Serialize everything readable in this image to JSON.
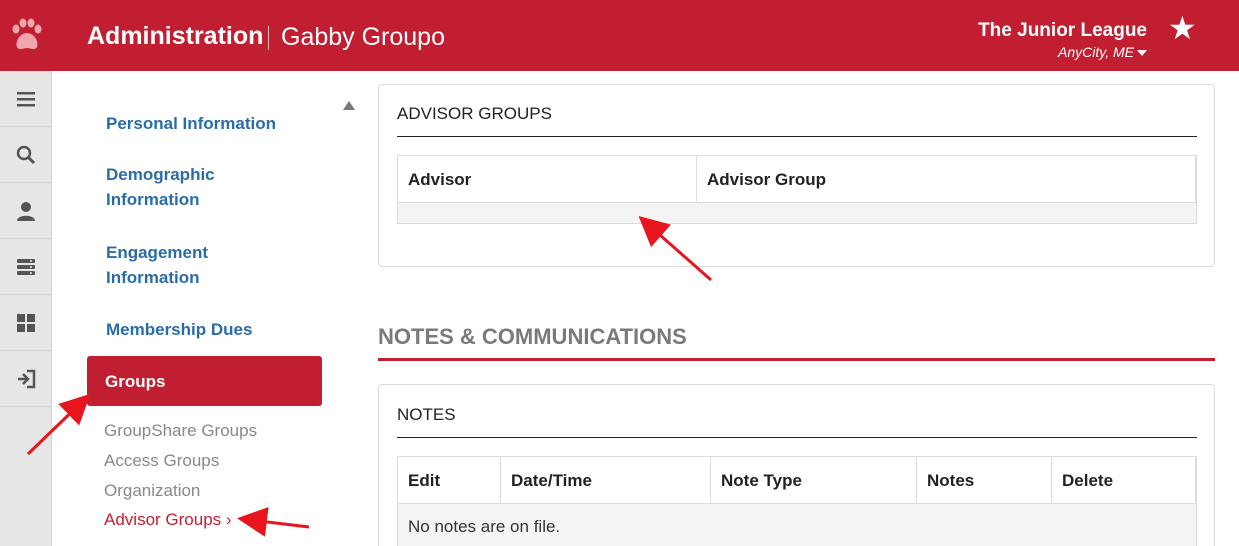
{
  "header": {
    "title": "Administration",
    "subtitle": "Gabby Groupo",
    "org_name": "The Junior League",
    "org_location": "AnyCity, ME",
    "brand_color": "#c11f31"
  },
  "rail": {
    "icons": [
      "menu-icon",
      "search-icon",
      "user-icon",
      "server-icon",
      "dashboard-icon",
      "sign-out-icon"
    ]
  },
  "sidenav": {
    "personal": "Personal Information",
    "demographic": "Demographic Information",
    "engagement": "Engagement Information",
    "dues": "Membership Dues",
    "groups": "Groups",
    "sub": {
      "groupshare": "GroupShare Groups",
      "access": "Access Groups",
      "organization": "Organization",
      "advisor": "Advisor Groups ›"
    }
  },
  "advisor_panel": {
    "title": "ADVISOR GROUPS",
    "columns": [
      "Advisor",
      "Advisor Group"
    ]
  },
  "notes_section": {
    "heading": "NOTES & COMMUNICATIONS"
  },
  "notes_panel": {
    "title": "NOTES",
    "columns": [
      "Edit",
      "Date/Time",
      "Note Type",
      "Notes",
      "Delete"
    ],
    "empty_message": "No notes are on file."
  }
}
